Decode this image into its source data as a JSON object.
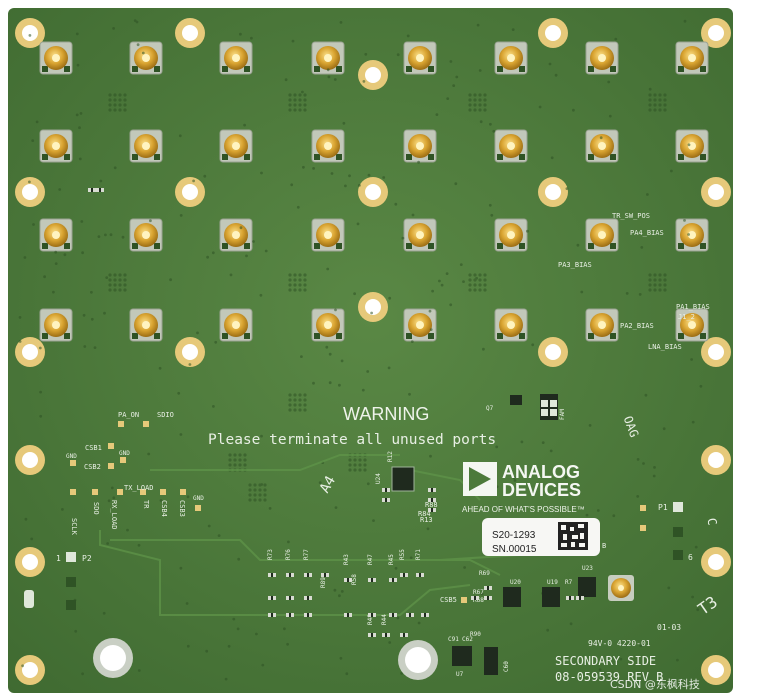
{
  "board": {
    "colors": {
      "pcb": "#4c7a3b",
      "pcb_dark": "#3f6a31",
      "gold": "#d9a431",
      "pad": "#e6c97a",
      "silk": "#e8efe4",
      "white_bg": "#ffffff"
    },
    "warning_title": "WARNING",
    "warning_text": "Please terminate all unused ports",
    "logo_line1": "ANALOG",
    "logo_line2": "DEVICES",
    "tagline": "AHEAD OF WHAT'S POSSIBLE™",
    "label_part": "S20-1293",
    "label_sn": "SN.00015",
    "side_label": "SECONDARY SIDE",
    "part_number": "08-059539 REV B",
    "ul_mark": "94V-0 4220-01",
    "date_code": "01-03",
    "t3": "T3",
    "a4": "A4",
    "watermark": "CSDN @东枫科技",
    "signals": {
      "tr_sw_pos": "TR_SW_POS",
      "pa4_bias": "PA4_BIAS",
      "pa3_bias": "PA3_BIAS",
      "pa1_bias": "PA1_BIAS",
      "pa2_bias": "PA2_BIAS",
      "lna_bias": "LNA_BIAS",
      "j1_2": "J1_2",
      "pa_on": "PA_ON",
      "sdio": "SDIO",
      "csb1": "CSB1",
      "csb2": "CSB2",
      "gnd": "GND",
      "sclk": "SCLK",
      "sdo": "SDO",
      "rx_load": "RX_LOAD",
      "tx_load": "TX_LOAD",
      "tr": "TR",
      "csb4": "CSB4",
      "csb3": "CSB3",
      "p1": "P1",
      "p2": "P2",
      "csb5": "CSB5"
    },
    "ref_designators": {
      "u24": "U24",
      "u20": "U20",
      "u19": "U19",
      "u7": "U7",
      "u23": "U23",
      "r88": "R88",
      "r84": "R84",
      "r13": "R13",
      "r12": "R12",
      "r7": "R7",
      "r58": "R58",
      "r71": "R71",
      "r55": "R55",
      "r47": "R47",
      "r48": "R48",
      "r43": "R43",
      "r44": "R44",
      "r45": "R45",
      "r73": "R73",
      "r76": "R76",
      "r77": "R77",
      "r89": "R89",
      "r90": "R90",
      "r67": "R67",
      "r68": "R68",
      "r69": "R69",
      "fam": "FAM",
      "q7": "Q7",
      "c91": "C91",
      "c62": "C62",
      "c60": "C60"
    },
    "pin_numbers": {
      "one": "1",
      "six": "6"
    },
    "mark_c": "C",
    "mark_b": "B",
    "oag": "OAG"
  }
}
